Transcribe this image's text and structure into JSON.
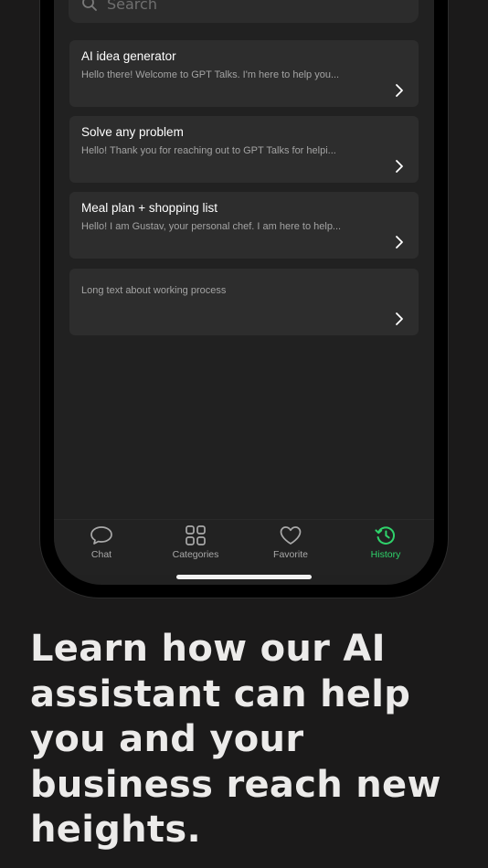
{
  "search": {
    "placeholder": "Search"
  },
  "history": [
    {
      "title": "AI idea generator",
      "preview": "Hello there! Welcome to GPT Talks. I'm here to help you..."
    },
    {
      "title": "Solve any problem",
      "preview": "Hello! Thank you for reaching out to GPT Talks for helpi..."
    },
    {
      "title": "Meal plan + shopping list",
      "preview": "Hello! I am Gustav, your personal chef. I am here to help..."
    },
    {
      "title": "",
      "preview": "Long text about working process"
    }
  ],
  "tabbar": {
    "items": [
      {
        "label": "Chat",
        "icon": "chat-bubble-icon",
        "active": false
      },
      {
        "label": "Categories",
        "icon": "grid-icon",
        "active": false
      },
      {
        "label": "Favorite",
        "icon": "heart-icon",
        "active": false
      },
      {
        "label": "History",
        "icon": "history-clock-icon",
        "active": true
      }
    ],
    "active_color": "#2fd36b",
    "inactive_color": "#a9a9a9"
  },
  "headline": "Learn how our AI assistant can help you and your business reach new heights."
}
